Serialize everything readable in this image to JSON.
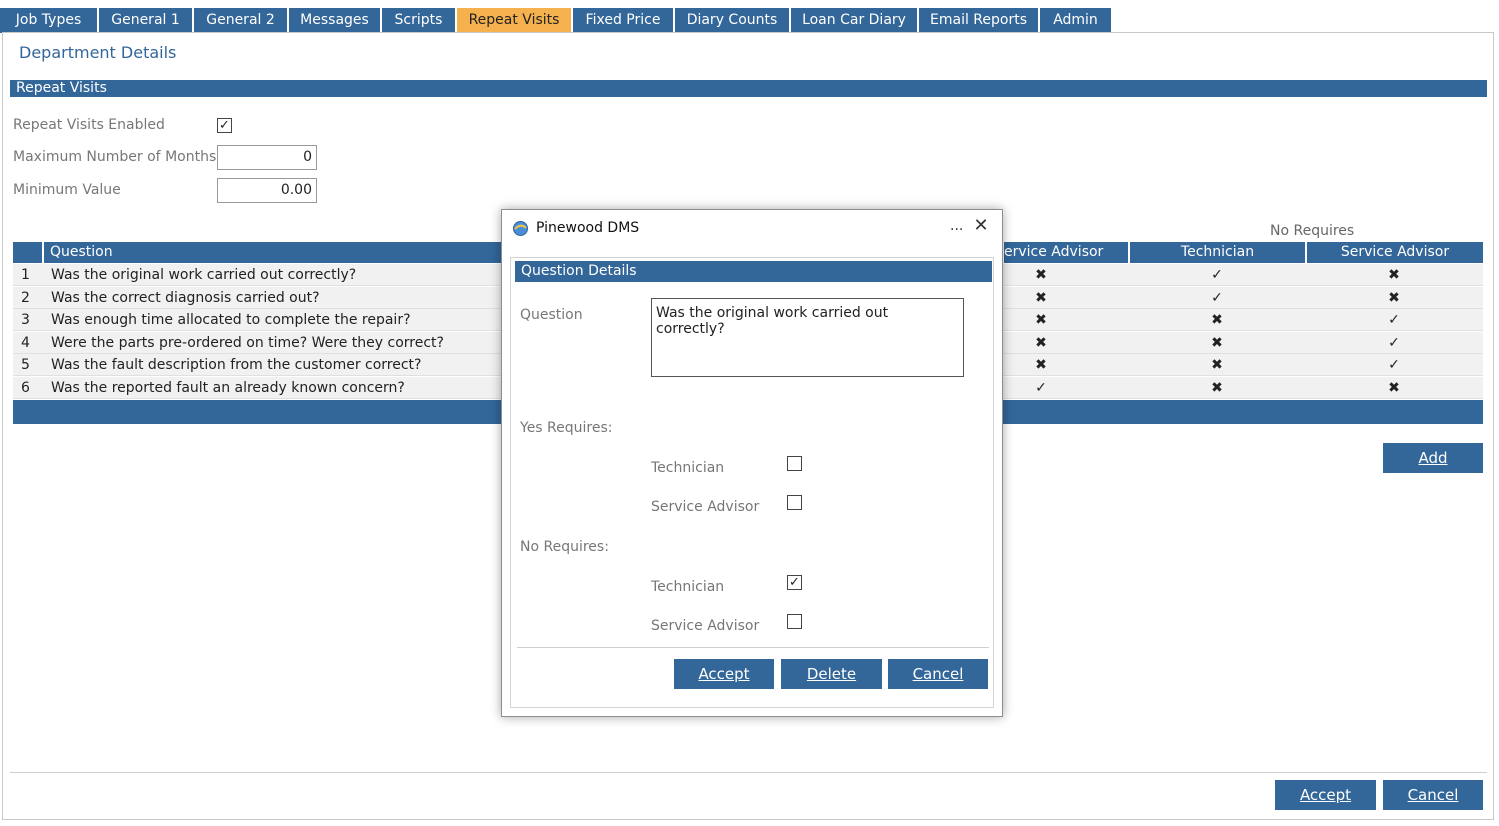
{
  "tabs": [
    {
      "label": "Job Types"
    },
    {
      "label": "General 1"
    },
    {
      "label": "General 2"
    },
    {
      "label": "Messages"
    },
    {
      "label": "Scripts"
    },
    {
      "label": "Repeat Visits",
      "active": true
    },
    {
      "label": "Fixed Price"
    },
    {
      "label": "Diary Counts"
    },
    {
      "label": "Loan Car Diary"
    },
    {
      "label": "Email Reports"
    },
    {
      "label": "Admin"
    }
  ],
  "page": {
    "title": "Department Details",
    "section": "Repeat Visits",
    "repeat_visits_enabled_label": "Repeat Visits Enabled",
    "repeat_visits_enabled": true,
    "max_months_label": "Maximum Number of Months",
    "max_months_value": "0",
    "min_value_label": "Minimum Value",
    "min_value_value": "0.00"
  },
  "grid": {
    "no_requires_label": "No Requires",
    "headers": {
      "question": "Question",
      "yes_service_advisor": "ervice Advisor",
      "no_technician": "Technician",
      "no_service_advisor": "Service Advisor"
    },
    "rows": [
      {
        "num": "1",
        "question": "Was the original work carried out correctly?",
        "yes_sa": "no",
        "no_tech": "yes",
        "no_sa": "no"
      },
      {
        "num": "2",
        "question": "Was the correct diagnosis carried out?",
        "yes_sa": "no",
        "no_tech": "yes",
        "no_sa": "no"
      },
      {
        "num": "3",
        "question": "Was enough time allocated to complete the repair?",
        "yes_sa": "no",
        "no_tech": "no",
        "no_sa": "yes"
      },
      {
        "num": "4",
        "question": "Were the parts pre-ordered on time? Were they correct?",
        "yes_sa": "no",
        "no_tech": "no",
        "no_sa": "yes"
      },
      {
        "num": "5",
        "question": "Was the fault description from the customer correct?",
        "yes_sa": "no",
        "no_tech": "no",
        "no_sa": "yes"
      },
      {
        "num": "6",
        "question": "Was the reported fault an already known concern?",
        "yes_sa": "yes",
        "no_tech": "no",
        "no_sa": "no"
      }
    ]
  },
  "buttons": {
    "add": "Add",
    "accept": "Accept",
    "cancel": "Cancel"
  },
  "dialog": {
    "title": "Pinewood DMS",
    "ellipsis": "...",
    "close": "✕",
    "section": "Question Details",
    "question_label": "Question",
    "question_value": "Was the original work carried out correctly?",
    "yes_requires_label": "Yes Requires:",
    "no_requires_label": "No Requires:",
    "technician_label": "Technician",
    "service_advisor_label": "Service Advisor",
    "yes_technician": false,
    "yes_service_advisor": false,
    "no_technician": true,
    "no_service_advisor": false,
    "accept": "Accept",
    "delete": "Delete",
    "cancel": "Cancel"
  },
  "colors": {
    "accent": "#336699",
    "active_tab": "#f5b14e",
    "yes_mark": "#2e8b2e",
    "no_mark": "#d42020"
  },
  "icons": {
    "yes": "✓",
    "no": "✖",
    "checked": "✓"
  }
}
